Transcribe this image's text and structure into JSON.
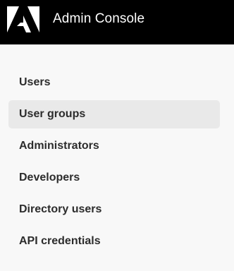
{
  "header": {
    "logo_icon": "adobe-logo-icon",
    "title": "Admin Console",
    "background": "#000000"
  },
  "sidebar": {
    "selected_index": 1,
    "items": [
      {
        "label": "Users"
      },
      {
        "label": "User groups"
      },
      {
        "label": "Administrators"
      },
      {
        "label": "Developers"
      },
      {
        "label": "Directory users"
      },
      {
        "label": "API credentials"
      }
    ]
  }
}
